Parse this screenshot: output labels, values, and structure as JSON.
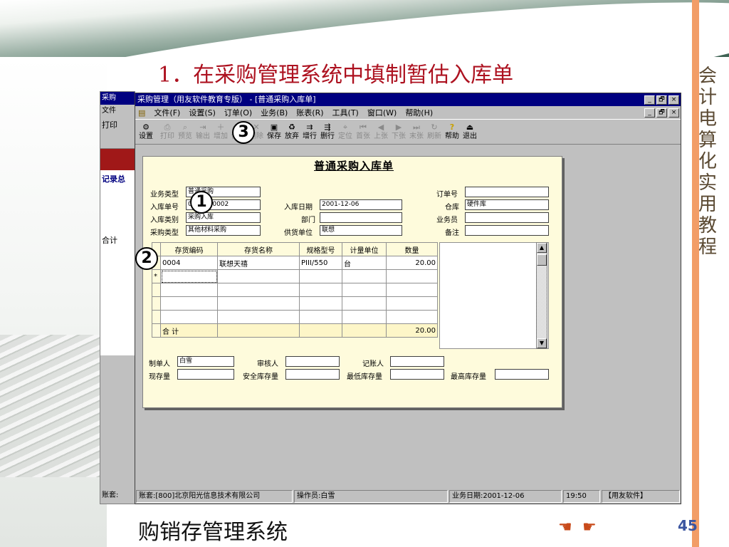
{
  "slide": {
    "title": "1．在采购管理系统中填制暂估入库单",
    "side_title": "会计电算化实用教程",
    "footer": "购销存管理系统",
    "page_number": "45",
    "colors": {
      "title": "#ad1220",
      "accent_bar": "#f29d67",
      "window_title": "#000080",
      "form_bg": "#fefbdc"
    }
  },
  "back_window": {
    "title": "采购",
    "menu": "文件",
    "tool": "打印",
    "heading": "记录总",
    "total": "合计",
    "status": "账套:"
  },
  "window": {
    "title": "采购管理（用友软件教育专版） - [普通采购入库单]",
    "minimize": "_",
    "restore": "🗗",
    "close": "×"
  },
  "menu": [
    "文件(F)",
    "设置(S)",
    "订单(O)",
    "业务(B)",
    "账表(R)",
    "工具(T)",
    "窗口(W)",
    "帮助(H)"
  ],
  "toolbar": [
    {
      "label": "设置",
      "icon": "gear-icon",
      "enabled": true
    },
    {
      "label": "打印",
      "icon": "printer-icon",
      "enabled": false
    },
    {
      "label": "预览",
      "icon": "preview-icon",
      "enabled": false
    },
    {
      "label": "输出",
      "icon": "export-icon",
      "enabled": false
    },
    {
      "label": "增加",
      "icon": "add-icon",
      "enabled": false
    },
    {
      "label": "修改",
      "icon": "edit-icon",
      "enabled": false
    },
    {
      "label": "删除",
      "icon": "delete-icon",
      "enabled": false
    },
    {
      "label": "保存",
      "icon": "save-icon",
      "enabled": true
    },
    {
      "label": "放弃",
      "icon": "discard-icon",
      "enabled": true
    },
    {
      "label": "增行",
      "icon": "add-row-icon",
      "enabled": true
    },
    {
      "label": "删行",
      "icon": "delete-row-icon",
      "enabled": true
    },
    {
      "label": "定位",
      "icon": "locate-icon",
      "enabled": false
    },
    {
      "label": "首张",
      "icon": "first-icon",
      "enabled": false
    },
    {
      "label": "上张",
      "icon": "prev-icon",
      "enabled": false
    },
    {
      "label": "下张",
      "icon": "next-icon",
      "enabled": false
    },
    {
      "label": "末张",
      "icon": "last-icon",
      "enabled": false
    },
    {
      "label": "刷新",
      "icon": "refresh-icon",
      "enabled": false
    },
    {
      "label": "帮助",
      "icon": "help-icon",
      "enabled": true
    },
    {
      "label": "退出",
      "icon": "exit-icon",
      "enabled": true
    }
  ],
  "form": {
    "title": "普通采购入库单",
    "labels": {
      "biz_type": "业务类型",
      "receipt_no": "入库单号",
      "receipt_type": "入库类别",
      "purchase_type": "采购类型",
      "receipt_date": "入库日期",
      "dept": "部门",
      "supplier": "供货单位",
      "order_no": "订单号",
      "warehouse": "仓库",
      "salesman": "业务员",
      "remark": "备注"
    },
    "values": {
      "biz_type": "普通采购",
      "receipt_no": "0000000002",
      "receipt_type": "采购入库",
      "purchase_type": "其他材料采购",
      "receipt_date": "2001-12-06",
      "dept": "",
      "supplier": "联想",
      "order_no": "",
      "warehouse": "硬件库",
      "salesman": "",
      "remark": ""
    },
    "grid": {
      "headers": [
        "存货编码",
        "存货名称",
        "规格型号",
        "计量单位",
        "数量"
      ],
      "rows": [
        [
          "0004",
          "联想天禧",
          "PIII/550",
          "台",
          "20.00"
        ]
      ],
      "new_row_marker": "*",
      "total_label": "合 计",
      "total_qty": "20.00"
    },
    "footer_labels": {
      "maker": "制单人",
      "auditor": "审核人",
      "bookkeeper": "记账人",
      "stock": "现存量",
      "safety_stock": "安全库存量",
      "min_stock": "最低库存量",
      "max_stock": "最高库存量"
    },
    "footer_values": {
      "maker": "白雪"
    }
  },
  "status": {
    "account": "账套:[800]北京阳光信息技术有限公司",
    "operator": "操作员:白雪",
    "biz_date": "业务日期:2001-12-06",
    "time": "19:50",
    "brand": "【用友软件】"
  },
  "callouts": [
    "1",
    "2",
    "3"
  ]
}
